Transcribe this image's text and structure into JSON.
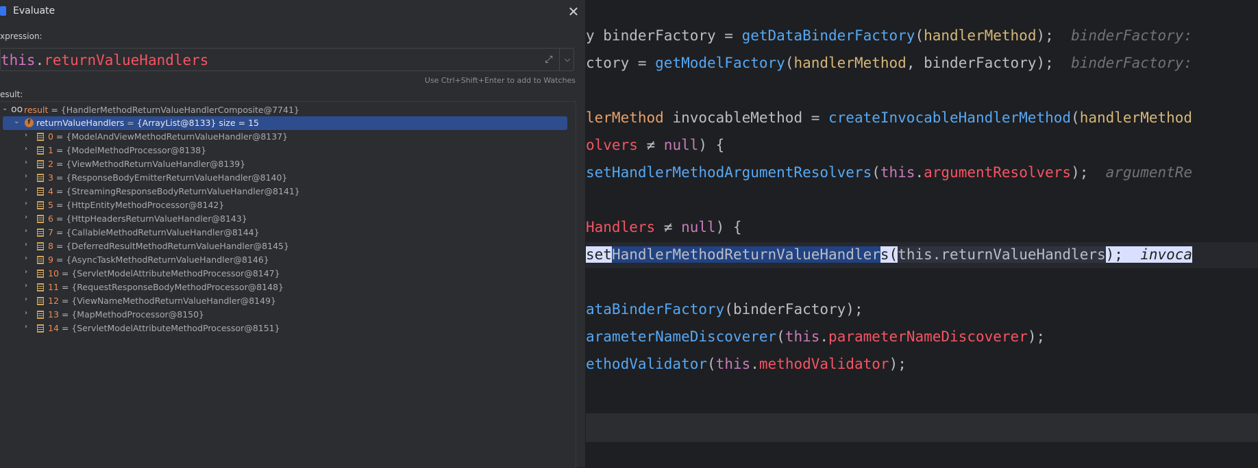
{
  "dialog": {
    "title": "Evaluate",
    "close_icon": "close-icon",
    "expression_label": "xpression:",
    "expression": {
      "this": "this",
      "dot": ".",
      "field": "returnValueHandlers"
    },
    "hint": "Use Ctrl+Shift+Enter to add to Watches",
    "result_label": "esult:"
  },
  "tree": {
    "root": {
      "name": "result",
      "eq": " = ",
      "value": "{HandlerMethodReturnValueHandlerComposite@7741}"
    },
    "selected": {
      "name": "returnValueHandlers",
      "eq": " = ",
      "value": "{ArrayList@8133}  size = 15"
    },
    "items": [
      {
        "index": "0",
        "value": "{ModelAndViewMethodReturnValueHandler@8137}"
      },
      {
        "index": "1",
        "value": "{ModelMethodProcessor@8138}"
      },
      {
        "index": "2",
        "value": "{ViewMethodReturnValueHandler@8139}"
      },
      {
        "index": "3",
        "value": "{ResponseBodyEmitterReturnValueHandler@8140}"
      },
      {
        "index": "4",
        "value": "{StreamingResponseBodyReturnValueHandler@8141}"
      },
      {
        "index": "5",
        "value": "{HttpEntityMethodProcessor@8142}"
      },
      {
        "index": "6",
        "value": "{HttpHeadersReturnValueHandler@8143}"
      },
      {
        "index": "7",
        "value": "{CallableMethodReturnValueHandler@8144}"
      },
      {
        "index": "8",
        "value": "{DeferredResultMethodReturnValueHandler@8145}"
      },
      {
        "index": "9",
        "value": "{AsyncTaskMethodReturnValueHandler@8146}"
      },
      {
        "index": "10",
        "value": "{ServletModelAttributeMethodProcessor@8147}"
      },
      {
        "index": "11",
        "value": "{RequestResponseBodyMethodProcessor@8148}"
      },
      {
        "index": "12",
        "value": "{ViewNameMethodReturnValueHandler@8149}"
      },
      {
        "index": "13",
        "value": "{MapMethodProcessor@8150}"
      },
      {
        "index": "14",
        "value": "{ServletModelAttributeMethodProcessor@8151}"
      }
    ]
  },
  "editor": {
    "l1": {
      "a": "y binderFactory = ",
      "fn": "getDataBinderFactory",
      "b": "(",
      "p": "handlerMethod",
      "c": ");",
      "hint": "binderFactory: "
    },
    "l2": {
      "a": "ctory = ",
      "fn": "getModelFactory",
      "b": "(",
      "p": "handlerMethod",
      "c": ", binderFactory);",
      "hint": "binderFactory:"
    },
    "l3": {
      "t": "lerMethod",
      "a": " invocableMethod = ",
      "fn": "createInvocableHandlerMethod",
      "b": "(",
      "p": "handlerMethod"
    },
    "l4": {
      "p": "olvers",
      "a": " ≠ ",
      "kw": "null",
      "b": ") {"
    },
    "l5": {
      "fn": "setHandlerMethodArgumentResolvers",
      "a": "(",
      "th": "this",
      "d": ".",
      "f": "argumentResolvers",
      "c": ");",
      "hint": "argumentRe"
    },
    "l6": {
      "p": "Handlers",
      "a": " ≠ ",
      "kw": "null",
      "b": ") {"
    },
    "l7": {
      "a": "set",
      "sel": "HandlerMethodReturnValueHandler",
      "s": "s",
      "b": "(",
      "th": "this.returnValueHandlers",
      "c": ");",
      "hint": "invoca"
    },
    "l8": {
      "fn": "ataBinderFactory",
      "a": "(binderFactory);"
    },
    "l9": {
      "fn": "arameterNameDiscoverer",
      "a": "(",
      "th": "this",
      "d": ".",
      "f": "parameterNameDiscoverer",
      "c": ");"
    },
    "l10": {
      "fn": "ethodValidator",
      "a": "(",
      "th": "this",
      "d": ".",
      "f": "methodValidator",
      "c": ");"
    }
  }
}
